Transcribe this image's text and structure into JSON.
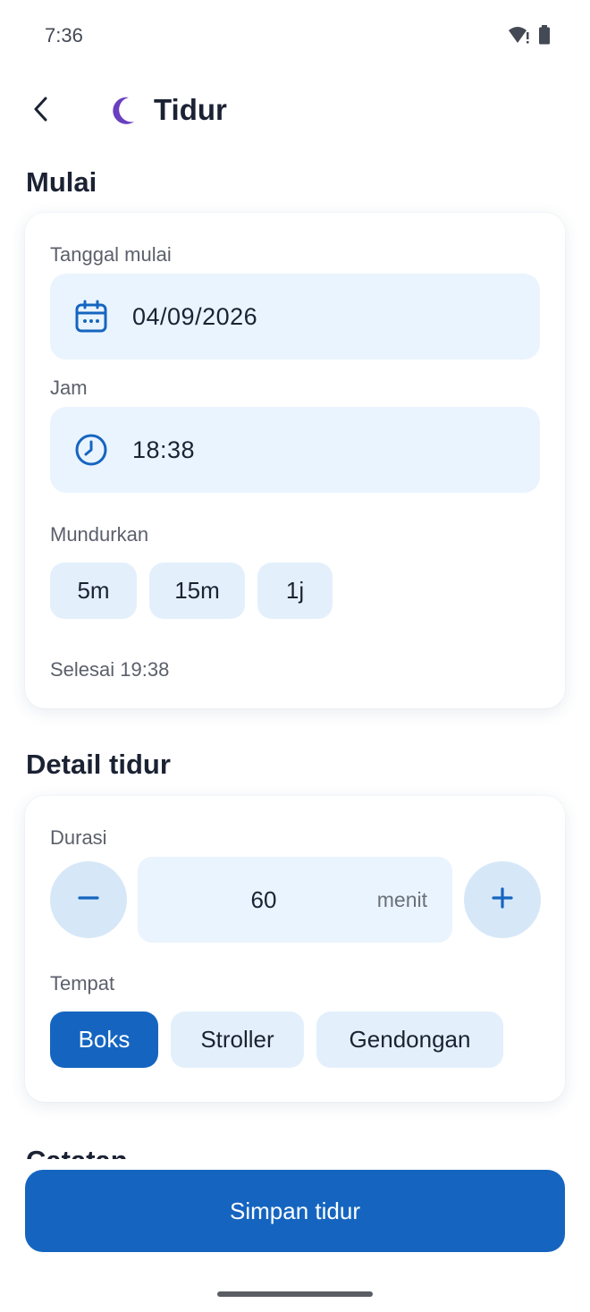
{
  "status_bar": {
    "time": "7:36",
    "icons": [
      "wifi-alert-icon",
      "battery-icon"
    ]
  },
  "app_bar": {
    "title": "Tidur",
    "back_icon": "arrow-left-icon",
    "title_icon": "moon-icon",
    "moon_color": "#6a3fbf"
  },
  "start_section": {
    "title": "Mulai",
    "date_label": "Tanggal mulai",
    "date_value": "04/09/2026",
    "time_label": "Jam",
    "time_value": "18:38",
    "rewind_label": "Mundurkan",
    "rewind_options": [
      "5m",
      "15m",
      "1j"
    ],
    "end_hint": "Selesai 19:38"
  },
  "detail_section": {
    "title": "Detail tidur",
    "duration_label": "Durasi",
    "duration_value": "60",
    "duration_unit": "menit",
    "place_label": "Tempat",
    "place_options": [
      "Boks",
      "Stroller",
      "Gendongan"
    ],
    "place_selected": "Boks"
  },
  "notes_section": {
    "title": "Catatan"
  },
  "save_button": {
    "label": "Simpan tidur"
  },
  "colors": {
    "primary": "#1565c0",
    "field_bg": "#eaf4fe",
    "chip_bg": "#e3f0fc"
  }
}
